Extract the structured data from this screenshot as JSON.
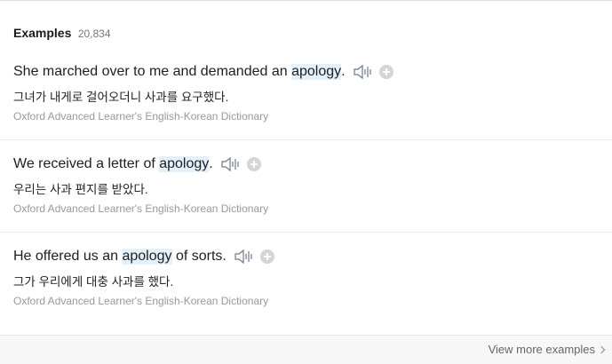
{
  "header": {
    "title": "Examples",
    "count": "20,834"
  },
  "examples": [
    {
      "pre": "She marched over to me and demanded an ",
      "term": "apology",
      "post": ".",
      "korean": "그녀가 내게로 걸어오더니 사과를 요구했다.",
      "source": "Oxford Advanced Learner's English-Korean Dictionary"
    },
    {
      "pre": "We received a letter of ",
      "term": "apology",
      "post": ".",
      "korean": "우리는 사과 편지를 받았다.",
      "source": "Oxford Advanced Learner's English-Korean Dictionary"
    },
    {
      "pre": "He offered us an ",
      "term": "apology",
      "post": " of sorts.",
      "korean": "그가 우리에게 대충 사과를 했다.",
      "source": "Oxford Advanced Learner's English-Korean Dictionary"
    }
  ],
  "footer": {
    "view_more": "View more examples"
  },
  "icons": {
    "speaker": "speaker-icon",
    "add": "plus-circle-icon",
    "chevron": "chevron-right-icon"
  },
  "colors": {
    "highlight": "#e4f1fb",
    "source_text": "#999999"
  }
}
